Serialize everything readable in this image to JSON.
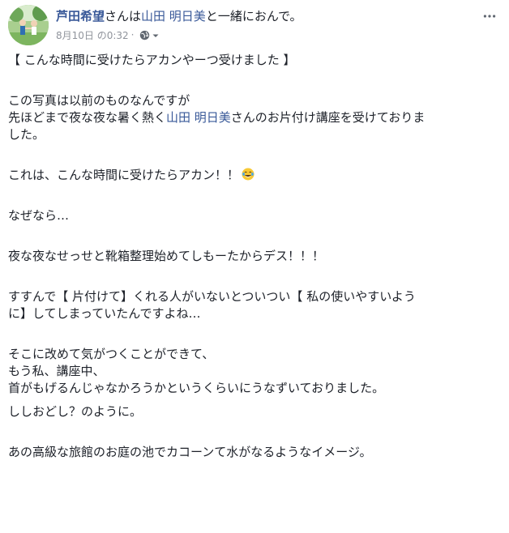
{
  "post": {
    "author": "芦田希望",
    "connector_prefix": "さんは",
    "tagged_person": "山田 明日美",
    "connector_suffix": "と一緒におんで。",
    "timestamp": "8月10日 の0:32",
    "separator": "·",
    "privacy_icon": "globe-icon",
    "menu_icon": "more-horizontal-icon"
  },
  "content": {
    "p1": "【 こんな時間に受けたらアカンやーつ受けました 】",
    "p2_line1": "この写真は以前のものなんですが",
    "p2_line2_before": "先ほどまで夜な夜な暑く熱く",
    "p2_line2_link": "山田 明日美",
    "p2_line2_after": "さんのお片付け講座を受けておりま",
    "p2_line3": "した。",
    "p3": "これは、こんな時間に受けたらアカン！！",
    "p3_emoji": "laughing-tears-emoji",
    "p4": "なぜなら…",
    "p5": "夜な夜なせっせと靴箱整理始めてしもーたからデス！！！",
    "p6_line1": "すすんで【 片付けて】くれる人がいないとついつい【 私の使いやすいよう",
    "p6_line2": "に】してしまっていたんですよね…",
    "p7_line1": "そこに改めて気がつくことができて、",
    "p7_line2": "もう私、講座中、",
    "p7_line3": "首がもげるんじゃなかろうかというくらいにうなずいておりました。",
    "p8": "ししおどし？のように。",
    "p9": "あの高級な旅館のお庭の池でカコーンて水がなるようなイメージ。"
  }
}
